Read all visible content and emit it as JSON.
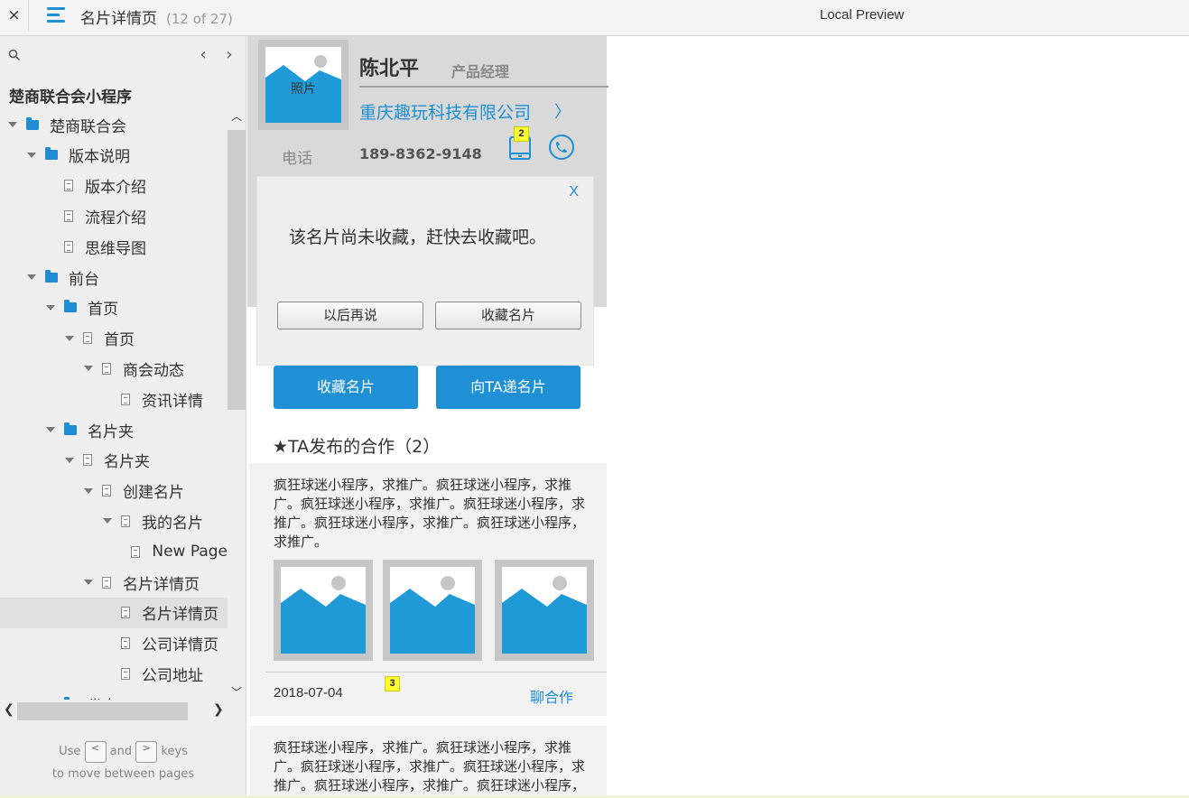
{
  "topbar": {
    "close_icon": "×",
    "title": "名片详情页",
    "count": "(12 of 27)",
    "preview_label": "Local Preview"
  },
  "sidebar": {
    "prev_icon": "‹",
    "next_icon": "›",
    "project": "楚商联合会小程序",
    "tree": [
      {
        "label": "楚商联合会",
        "type": "folder",
        "level": 0,
        "expanded": true
      },
      {
        "label": "版本说明",
        "type": "folder",
        "level": 1,
        "expanded": true
      },
      {
        "label": "版本介绍",
        "type": "page",
        "level": 2,
        "expanded": false
      },
      {
        "label": "流程介绍",
        "type": "page",
        "level": 2,
        "expanded": false
      },
      {
        "label": "思维导图",
        "type": "page",
        "level": 2,
        "expanded": false
      },
      {
        "label": "前台",
        "type": "folder",
        "level": 1,
        "expanded": true
      },
      {
        "label": "首页",
        "type": "folder",
        "level": 2,
        "expanded": true
      },
      {
        "label": "首页",
        "type": "page",
        "level": 3,
        "expanded": true
      },
      {
        "label": "商会动态",
        "type": "page",
        "level": 4,
        "expanded": true
      },
      {
        "label": "资讯详情",
        "type": "page",
        "level": 5,
        "expanded": false
      },
      {
        "label": "名片夹",
        "type": "folder",
        "level": 2,
        "expanded": true
      },
      {
        "label": "名片夹",
        "type": "page",
        "level": 3,
        "expanded": true
      },
      {
        "label": "创建名片",
        "type": "page",
        "level": 4,
        "expanded": true
      },
      {
        "label": "我的名片",
        "type": "page",
        "level": 5,
        "expanded": true
      },
      {
        "label": "New Page",
        "type": "page",
        "level": 6,
        "expanded": false
      },
      {
        "label": "名片详情页",
        "type": "page",
        "level": 4,
        "expanded": true
      },
      {
        "label": "名片详情页",
        "type": "page",
        "level": 5,
        "expanded": false,
        "selected": true
      },
      {
        "label": "公司详情页",
        "type": "page",
        "level": 5,
        "expanded": false
      },
      {
        "label": "公司地址",
        "type": "page",
        "level": 5,
        "expanded": false
      },
      {
        "label": "发布",
        "type": "folder",
        "level": 2,
        "expanded": true
      }
    ],
    "hint": {
      "use": "Use",
      "prev_key": "<",
      "and": "and",
      "next_key": ">",
      "keys": "keys",
      "line2": "to move between pages"
    }
  },
  "card": {
    "photo_label": "照片",
    "name": "陈北平",
    "role": "产品经理",
    "company": "重庆趣玩科技有限公司",
    "company_arrow": "〉",
    "phone_label": "电话",
    "phone": "189-8362-9148",
    "badge_mobile": "2"
  },
  "dialog": {
    "close_label": "X",
    "message": "该名片尚未收藏，赶快去收藏吧。",
    "later_button": "以后再说",
    "save_button": "收藏名片"
  },
  "actions": {
    "save_card": "收藏名片",
    "send_card": "向TA递名片"
  },
  "cooperation": {
    "title": "★TA发布的合作（2）",
    "posts": [
      {
        "text": "疯狂球迷小程序，求推广。疯狂球迷小程序，求推广。疯狂球迷小程序，求推广。疯狂球迷小程序，求推广。疯狂球迷小程序，求推广。疯狂球迷小程序，求推广。",
        "date": "2018-07-04",
        "link": "聊合作",
        "badge": "3"
      },
      {
        "text": "疯狂球迷小程序，求推广。疯狂球迷小程序，求推广。疯狂球迷小程序，求推广。疯狂球迷小程序，求推广。疯狂球迷小程序，求推广。疯狂球迷小程序，求推广。"
      }
    ]
  },
  "colors": {
    "accent": "#1f8fd6",
    "sidebar_bg": "#efefef",
    "card_bg": "#d9d9d9",
    "badge": "#ffff33"
  }
}
